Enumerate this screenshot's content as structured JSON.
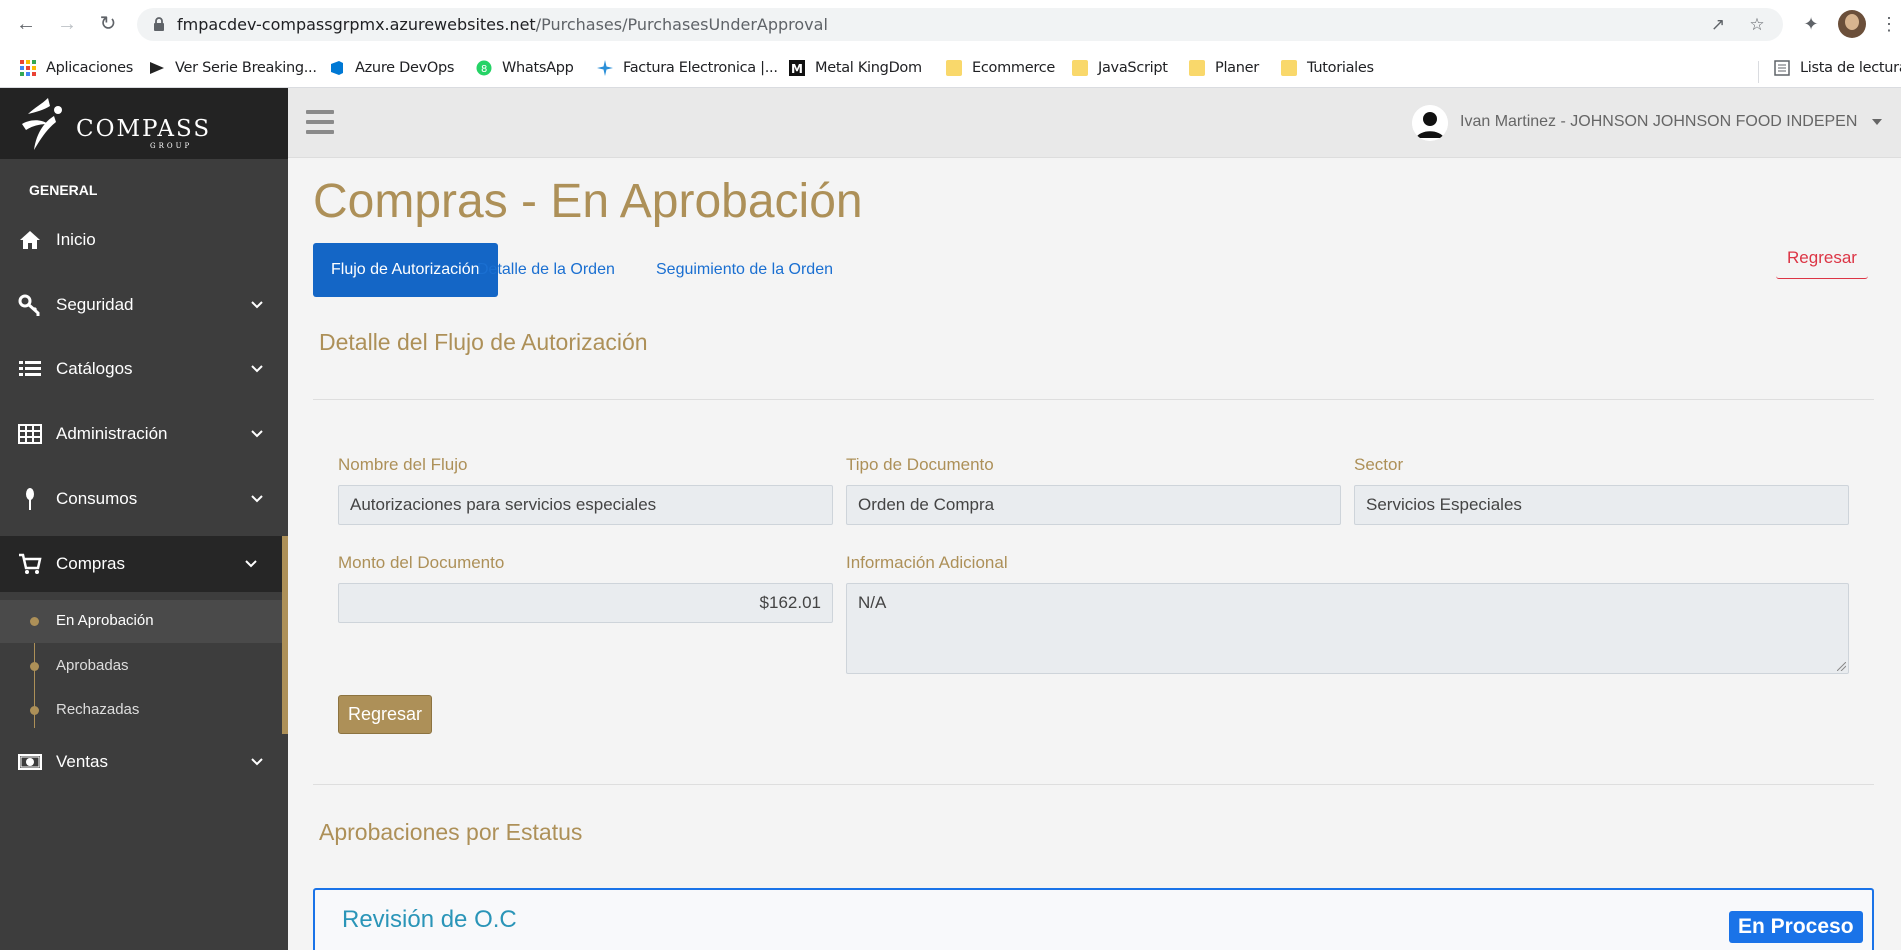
{
  "browser": {
    "url_host": "fmpacdev-compassgrpmx.azurewebsites.net",
    "url_path": "/Purchases/PurchasesUnderApproval",
    "bookmarks": [
      {
        "label": "Aplicaciones",
        "icon": "apps-grid-icon"
      },
      {
        "label": "Ver Serie Breaking...",
        "icon": "play-icon"
      },
      {
        "label": "Azure DevOps",
        "icon": "azure-devops-icon"
      },
      {
        "label": "WhatsApp",
        "icon": "whatsapp-icon"
      },
      {
        "label": "Factura Electronica |...",
        "icon": "sparkle-icon"
      },
      {
        "label": "Metal KingDom",
        "icon": "m-logo-icon"
      },
      {
        "label": "Ecommerce",
        "icon": "folder-icon"
      },
      {
        "label": "JavaScript",
        "icon": "folder-icon"
      },
      {
        "label": "Planer",
        "icon": "folder-icon"
      },
      {
        "label": "Tutoriales",
        "icon": "folder-icon"
      }
    ],
    "reading_list": "Lista de lectura"
  },
  "sidebar": {
    "logo_text": "COMPASS",
    "logo_sub": "GROUP",
    "section_title": "GENERAL",
    "items": [
      {
        "label": "Inicio",
        "icon": "home-icon"
      },
      {
        "label": "Seguridad",
        "icon": "key-icon"
      },
      {
        "label": "Catálogos",
        "icon": "list-icon"
      },
      {
        "label": "Administración",
        "icon": "table-icon"
      },
      {
        "label": "Consumos",
        "icon": "spoon-icon"
      },
      {
        "label": "Compras",
        "icon": "cart-icon"
      },
      {
        "label": "Ventas",
        "icon": "money-icon"
      }
    ],
    "sub_items": [
      {
        "label": "En Aprobación"
      },
      {
        "label": "Aprobadas"
      },
      {
        "label": "Rechazadas"
      }
    ]
  },
  "header": {
    "user_name": "Ivan Martinez - JOHNSON JOHNSON FOOD INDEPEN"
  },
  "main": {
    "title": "Compras - En Aprobación",
    "tabs": [
      {
        "label": "Flujo de Autorización"
      },
      {
        "label": "Detalle de la Orden"
      },
      {
        "label": "Seguimiento de la Orden"
      }
    ],
    "back_link": "Regresar",
    "flow_section": "Detalle del Flujo de Autorización",
    "fields": {
      "flow_name": {
        "label": "Nombre del Flujo",
        "value": "Autorizaciones para servicios especiales"
      },
      "doc_type": {
        "label": "Tipo de Documento",
        "value": "Orden de Compra"
      },
      "sector": {
        "label": "Sector",
        "value": "Servicios Especiales"
      },
      "amount": {
        "label": "Monto del Documento",
        "value": "$162.01"
      },
      "additional": {
        "label": "Información Adicional",
        "value": "N/A"
      }
    },
    "back_button": "Regresar",
    "status_section": "Aprobaciones por Estatus",
    "card": {
      "title": "Revisión de O.C",
      "badge": "En Proceso"
    }
  },
  "colors": {
    "accent_gold": "#ad9058",
    "primary_blue": "#1466c6",
    "danger": "#dc3545",
    "sidebar_bg": "#3d3d3d"
  }
}
